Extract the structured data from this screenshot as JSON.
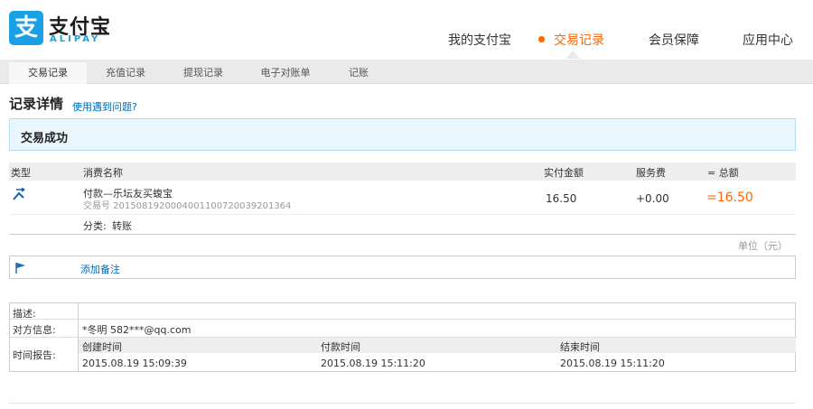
{
  "brand": {
    "name_cn": "支付宝",
    "name_en": "ALIPAY",
    "glyph": "支"
  },
  "topnav": [
    {
      "label": "我的支付宝",
      "active": false
    },
    {
      "label": "交易记录",
      "active": true
    },
    {
      "label": "会员保障",
      "active": false
    },
    {
      "label": "应用中心",
      "active": false
    }
  ],
  "subnav": [
    "交易记录",
    "充值记录",
    "提现记录",
    "电子对账单",
    "记账"
  ],
  "page": {
    "title": "记录详情",
    "help_link": "使用遇到问题?"
  },
  "status": "交易成功",
  "table": {
    "headers": {
      "type": "类型",
      "name": "消费名称",
      "amount": "实付金额",
      "fee": "服务费",
      "total": "= 总额"
    },
    "row": {
      "type_icon": "transfer-icon",
      "name": "付款—乐坛友买蝮宝",
      "trade_no": "交易号 2015081920004001100720039201364",
      "amount": "16.50",
      "fee": "+0.00",
      "total": "=16.50",
      "category_label": "分类:",
      "category_value": "转账"
    }
  },
  "unit": "单位（元）",
  "memo": {
    "icon": "flag-icon",
    "link": "添加备注"
  },
  "details": {
    "desc_label": "描述:",
    "desc_value": "",
    "counterparty_label": "对方信息:",
    "counterparty_value": "*冬明 582***@qq.com",
    "time_label": "时间报告:",
    "time_headers": [
      "创建时间",
      "付款时间",
      "结束时间"
    ],
    "time_values": [
      "2015.08.19 15:09:39",
      "2015.08.19 15:11:20",
      "2015.08.19 15:11:20"
    ]
  },
  "colors": {
    "brand": "#1aa1e5",
    "accent": "#ff6600",
    "link": "#0069b4",
    "success_bg": "#eaf6fd"
  }
}
